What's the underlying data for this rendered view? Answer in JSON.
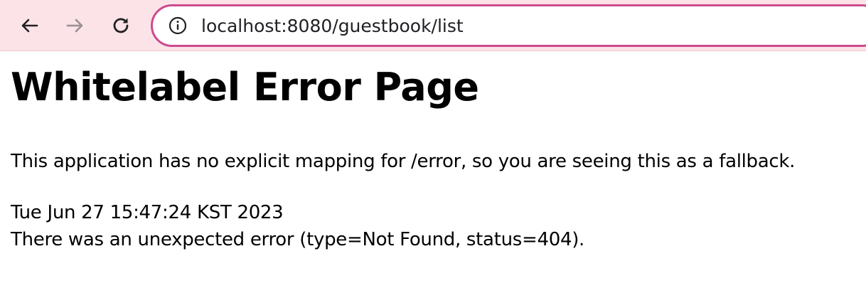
{
  "browser": {
    "url": "localhost:8080/guestbook/list",
    "icons": {
      "back": "back-arrow-icon",
      "forward": "forward-arrow-icon",
      "reload": "reload-icon",
      "site_info": "info-icon"
    },
    "colors": {
      "toolbar_bg": "#fbe3e8",
      "omnibox_border": "#cc4b8e"
    }
  },
  "page": {
    "title": "Whitelabel Error Page",
    "message": "This application has no explicit mapping for /error, so you are seeing this as a fallback.",
    "timestamp": "Tue Jun 27 15:47:24 KST 2023",
    "error_detail": "There was an unexpected error (type=Not Found, status=404)."
  }
}
